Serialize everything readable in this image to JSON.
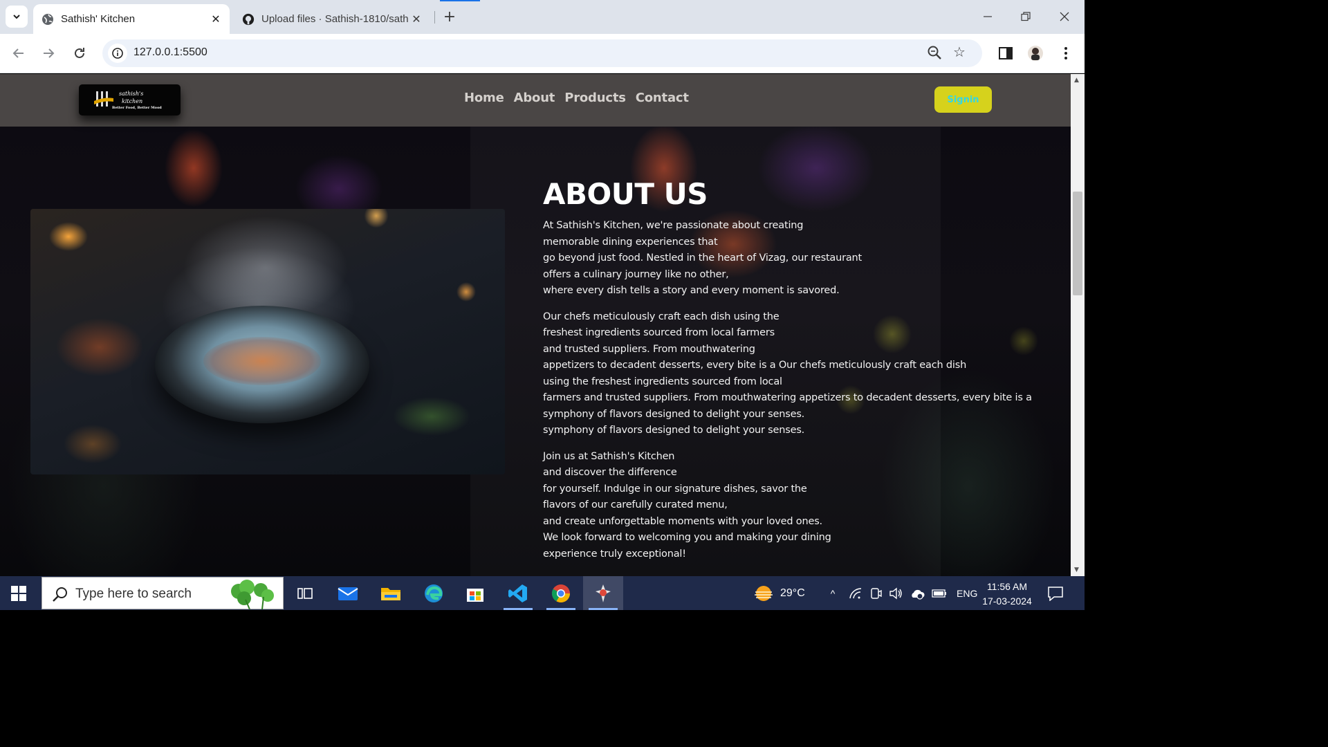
{
  "browser": {
    "tabs": [
      {
        "title": "Sathish' Kitchen",
        "active": true
      },
      {
        "title": "Upload files · Sathish-1810/sath",
        "active": false
      }
    ],
    "url": "127.0.0.1:5500"
  },
  "site": {
    "logo": {
      "line1": "sathish's",
      "line2": "kitchen",
      "tagline": "Better Food, Better Mood"
    },
    "nav": [
      "Home",
      "About",
      "Products",
      "Contact"
    ],
    "signin_label": "Signin"
  },
  "about": {
    "heading": "ABOUT US",
    "paragraphs": [
      "At Sathish's Kitchen, we're passionate about creating\nmemorable dining experiences that\ngo beyond just food. Nestled in the heart of Vizag, our restaurant\noffers a culinary journey like no other,\nwhere every dish tells a story and every moment is savored.",
      "Our chefs meticulously craft each dish using the\nfreshest ingredients sourced from local farmers\nand trusted suppliers. From mouthwatering\nappetizers to decadent desserts, every bite is a Our chefs meticulously craft each dish\nusing the freshest ingredients sourced from local\nfarmers and trusted suppliers. From mouthwatering appetizers to decadent desserts, every bite is a\nsymphony of flavors designed to delight your senses.\nsymphony of flavors designed to delight your senses.",
      "Join us at Sathish's Kitchen\nand discover the difference\nfor yourself. Indulge in our signature dishes, savor the\nflavors of our carefully curated menu,\nand create unforgettable moments with your loved ones.\nWe look forward to welcoming you and making your dining\nexperience truly exceptional!"
    ]
  },
  "taskbar": {
    "search_placeholder": "Type here to search",
    "weather": "29°C",
    "language": "ENG",
    "time": "11:56 AM",
    "date": "17-03-2024"
  },
  "colors": {
    "header_bg": "#4a4645",
    "signin_bg": "#d6d21c",
    "signin_text": "#33d6e6",
    "taskbar_bg": "#1f2a4a"
  }
}
